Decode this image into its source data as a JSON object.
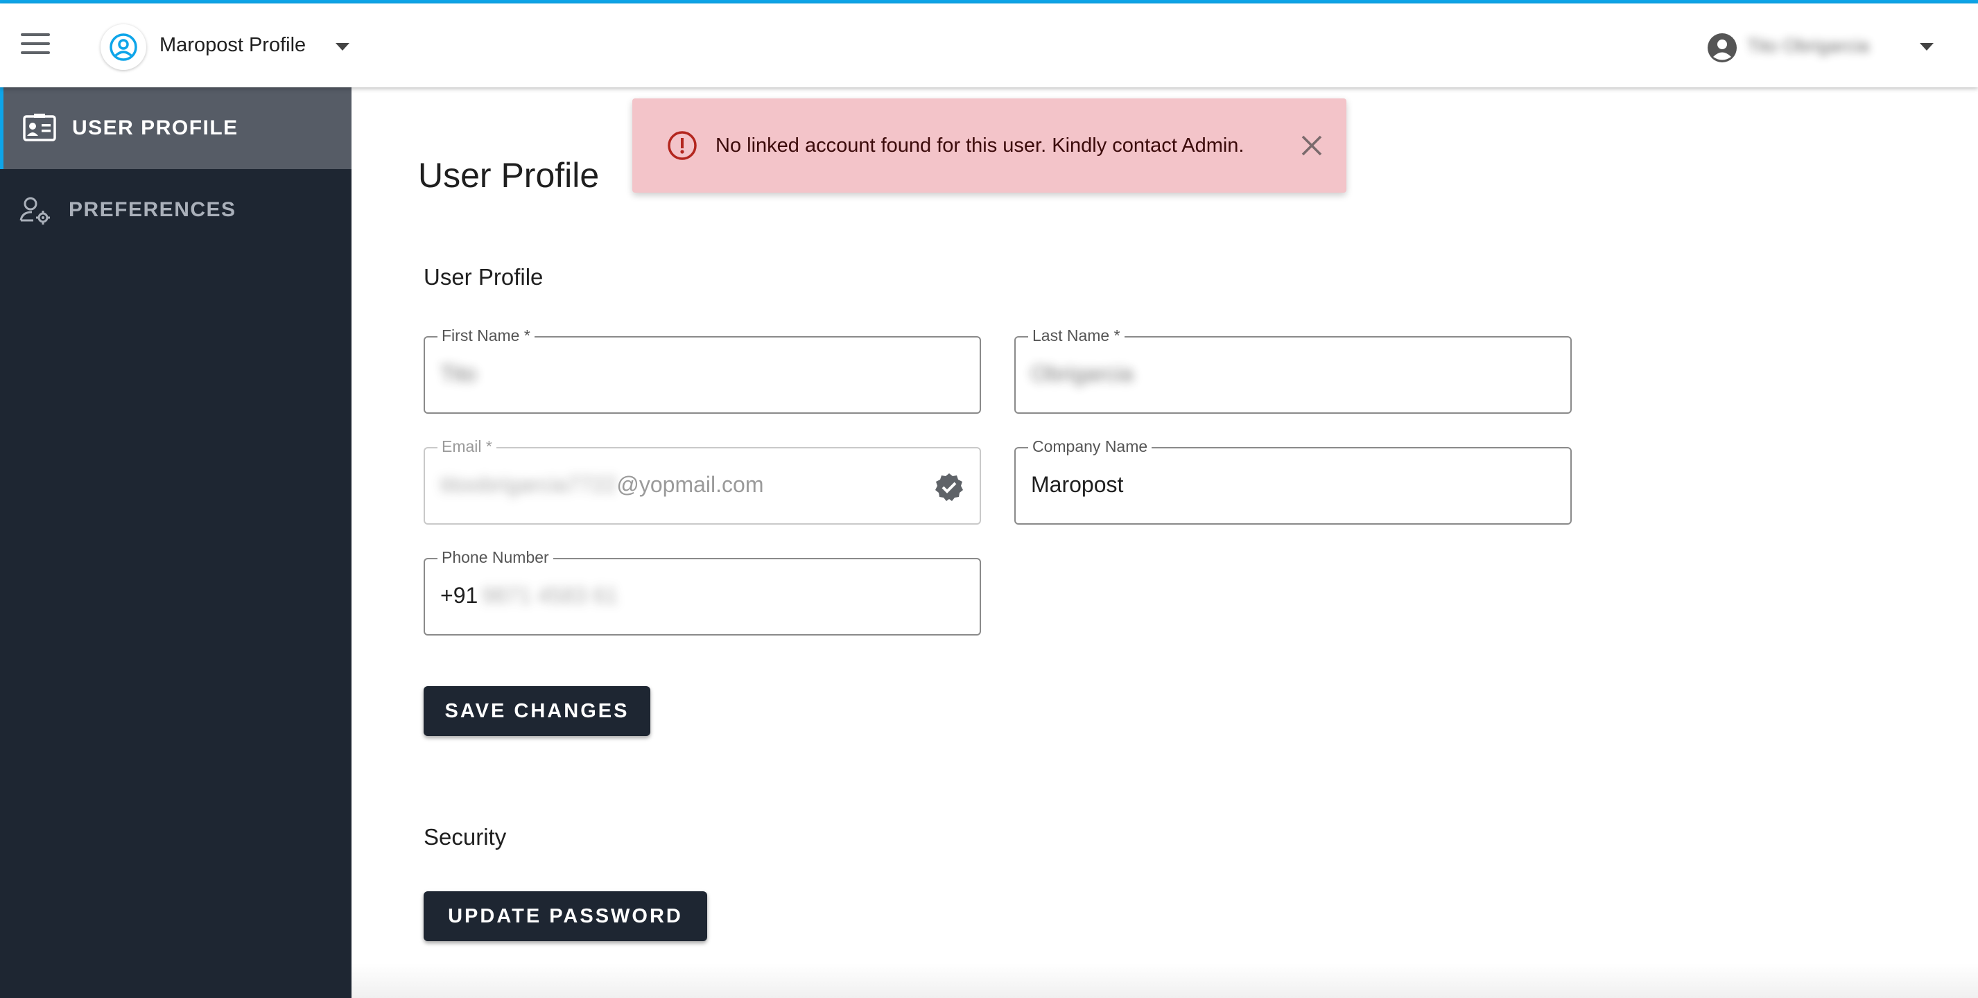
{
  "header": {
    "app_title": "Maropost Profile",
    "user_name": "Tito Obrigarcia",
    "accent": "#0ea5e9"
  },
  "sidebar": {
    "items": [
      {
        "label": "USER PROFILE",
        "icon": "id-card-icon",
        "active": true
      },
      {
        "label": "PREFERENCES",
        "icon": "user-settings-icon",
        "active": false
      }
    ]
  },
  "toast": {
    "message": "No linked account found for this user. Kindly contact Admin.",
    "type": "error",
    "color": "#f3c4c9"
  },
  "page": {
    "title": "User Profile",
    "profile_section": "User Profile",
    "security_section": "Security"
  },
  "form": {
    "first_name": {
      "label": "First Name *",
      "value": "Tito"
    },
    "last_name": {
      "label": "Last Name *",
      "value": "Obrigarcia"
    },
    "email": {
      "label": "Email *",
      "value_local": "titoobrigarcia7722",
      "value_domain": "@yopmail.com",
      "verified": true
    },
    "company": {
      "label": "Company Name",
      "value": "Maropost"
    },
    "phone": {
      "label": "Phone Number",
      "prefix": "+91",
      "value": "9871 4583 61"
    }
  },
  "buttons": {
    "save": "SAVE CHANGES",
    "update_password": "UPDATE PASSWORD"
  }
}
